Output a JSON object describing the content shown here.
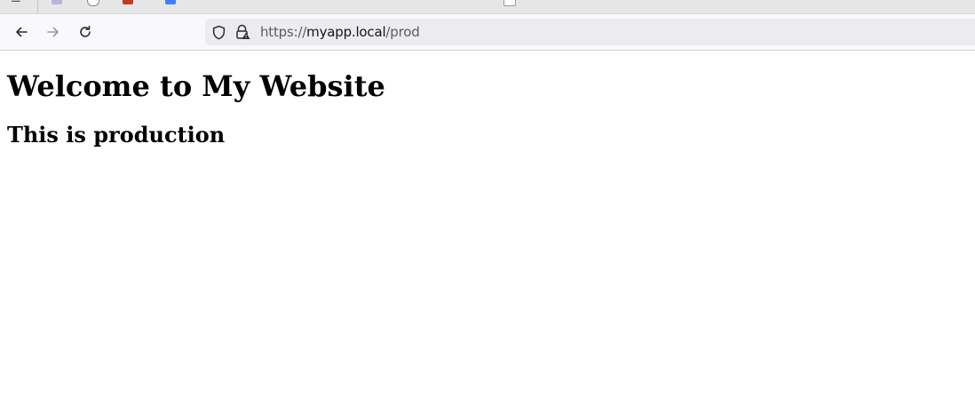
{
  "toolbar": {
    "url_scheme": "https://",
    "url_host": "myapp.local",
    "url_path": "/prod"
  },
  "icons": {
    "back": "back-arrow-icon",
    "forward": "forward-arrow-icon",
    "reload": "reload-icon",
    "shield": "tracking-protection-shield-icon",
    "lock": "insecure-lock-icon"
  },
  "colors": {
    "tabstrip_bg": "#e6e6e6",
    "toolbar_bg": "#f9f9fb",
    "urlbar_bg": "#ececee",
    "url_dim": "#5b5b66",
    "url_host": "#15141a"
  },
  "page": {
    "heading": "Welcome to My Website",
    "subheading": "This is production"
  }
}
